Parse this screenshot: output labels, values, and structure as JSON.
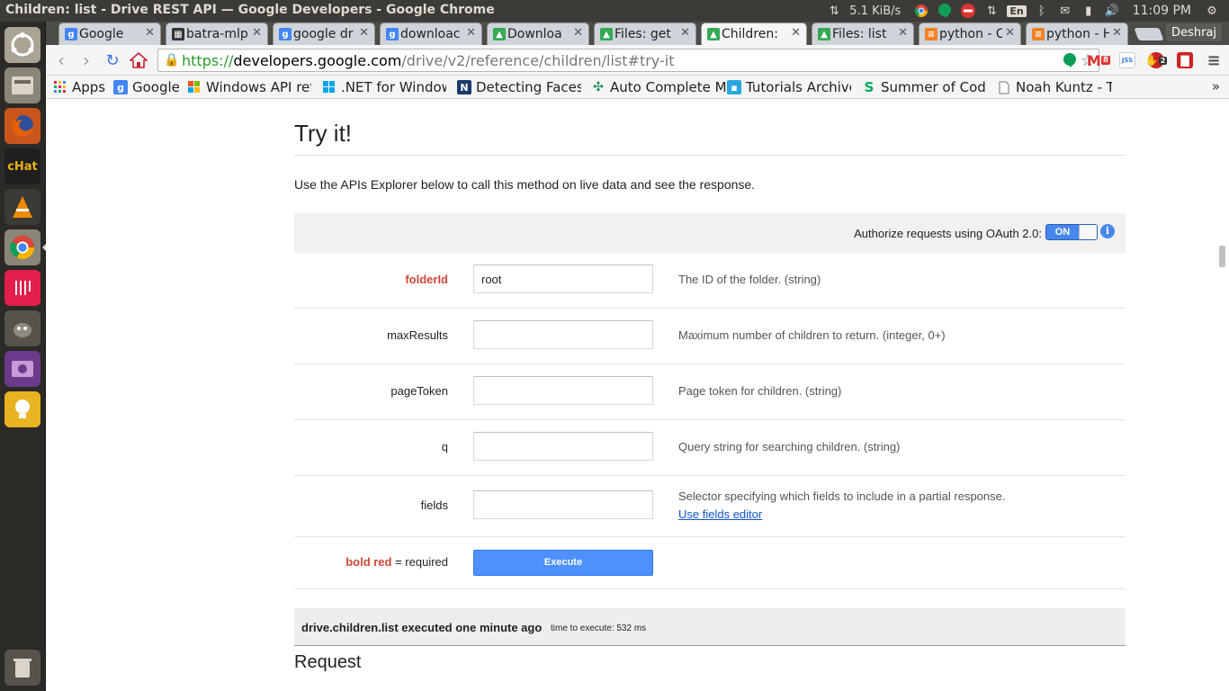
{
  "os": {
    "window_title": "Children: list - Drive REST API — Google Developers - Google Chrome",
    "net_speed": "5.1 KiB/s",
    "keyboard_layout": "En",
    "clock": "11:09 PM"
  },
  "browser": {
    "tabs": [
      {
        "label": "Google",
        "icon": "google-icon",
        "color": "#4285f4"
      },
      {
        "label": "batra-mlp",
        "icon": "github-icon",
        "color": "#333333"
      },
      {
        "label": "google dr",
        "icon": "google-icon",
        "color": "#4285f4"
      },
      {
        "label": "downloac",
        "icon": "google-icon",
        "color": "#4285f4"
      },
      {
        "label": "Downloa",
        "icon": "drive-icon",
        "color": "#34a853"
      },
      {
        "label": "Files: get",
        "icon": "drive-icon",
        "color": "#34a853"
      },
      {
        "label": "Children:",
        "icon": "drive-icon",
        "color": "#34a853",
        "active": true
      },
      {
        "label": "Files: list",
        "icon": "drive-icon",
        "color": "#34a853"
      },
      {
        "label": "python - C",
        "icon": "stackoverflow-icon",
        "color": "#f48024"
      },
      {
        "label": "python - H",
        "icon": "stackoverflow-icon",
        "color": "#f48024"
      }
    ],
    "profile_name": "Deshraj",
    "url": {
      "scheme": "https://",
      "host": "developers.google.com",
      "path": "/drive/v2/reference/children/list#try-it"
    },
    "extension_badges": {
      "gmail": "8",
      "adblock": "2"
    },
    "bookmarks": [
      {
        "label": "Apps",
        "icon": "apps-grid-icon"
      },
      {
        "label": "Google",
        "icon": "google-icon"
      },
      {
        "label": "Windows API refe",
        "icon": "windows-icon"
      },
      {
        "label": ".NET for Window",
        "icon": "windows-icon"
      },
      {
        "label": "Detecting Faces c",
        "icon": "n-icon"
      },
      {
        "label": "Auto Complete M",
        "icon": "autocomplete-icon"
      },
      {
        "label": "Tutorials Archive",
        "icon": "tutorials-icon"
      },
      {
        "label": "Summer of Code/",
        "icon": "s-icon"
      },
      {
        "label": "Noah Kuntz - Tuto",
        "icon": "page-icon"
      }
    ],
    "bookmarks_overflow": "»"
  },
  "page": {
    "heading": "Try it!",
    "intro": "Use the APIs Explorer below to call this method on live data and see the response.",
    "auth_label": "Authorize requests using OAuth 2.0:",
    "auth_toggle": "ON",
    "info_glyph": "i",
    "params": [
      {
        "name": "folderId",
        "required": true,
        "value": "root",
        "description": "The ID of the folder. (string)"
      },
      {
        "name": "maxResults",
        "required": false,
        "value": "",
        "description": "Maximum number of children to return. (integer, 0+)"
      },
      {
        "name": "pageToken",
        "required": false,
        "value": "",
        "description": "Page token for children. (string)"
      },
      {
        "name": "q",
        "required": false,
        "value": "",
        "description": "Query string for searching children. (string)"
      },
      {
        "name": "fields",
        "required": false,
        "value": "",
        "description": "Selector specifying which fields to include in a partial response.",
        "link": "Use fields editor"
      }
    ],
    "legend_required": "bold red",
    "legend_rest": " = required",
    "execute_label": "Execute",
    "result_main": "drive.children.list executed one minute ago",
    "result_time": "time to execute: 532 ms",
    "request_heading": "Request"
  },
  "colors": {
    "required": "#d14836",
    "button": "#4d90fe",
    "link": "#1155cc"
  }
}
